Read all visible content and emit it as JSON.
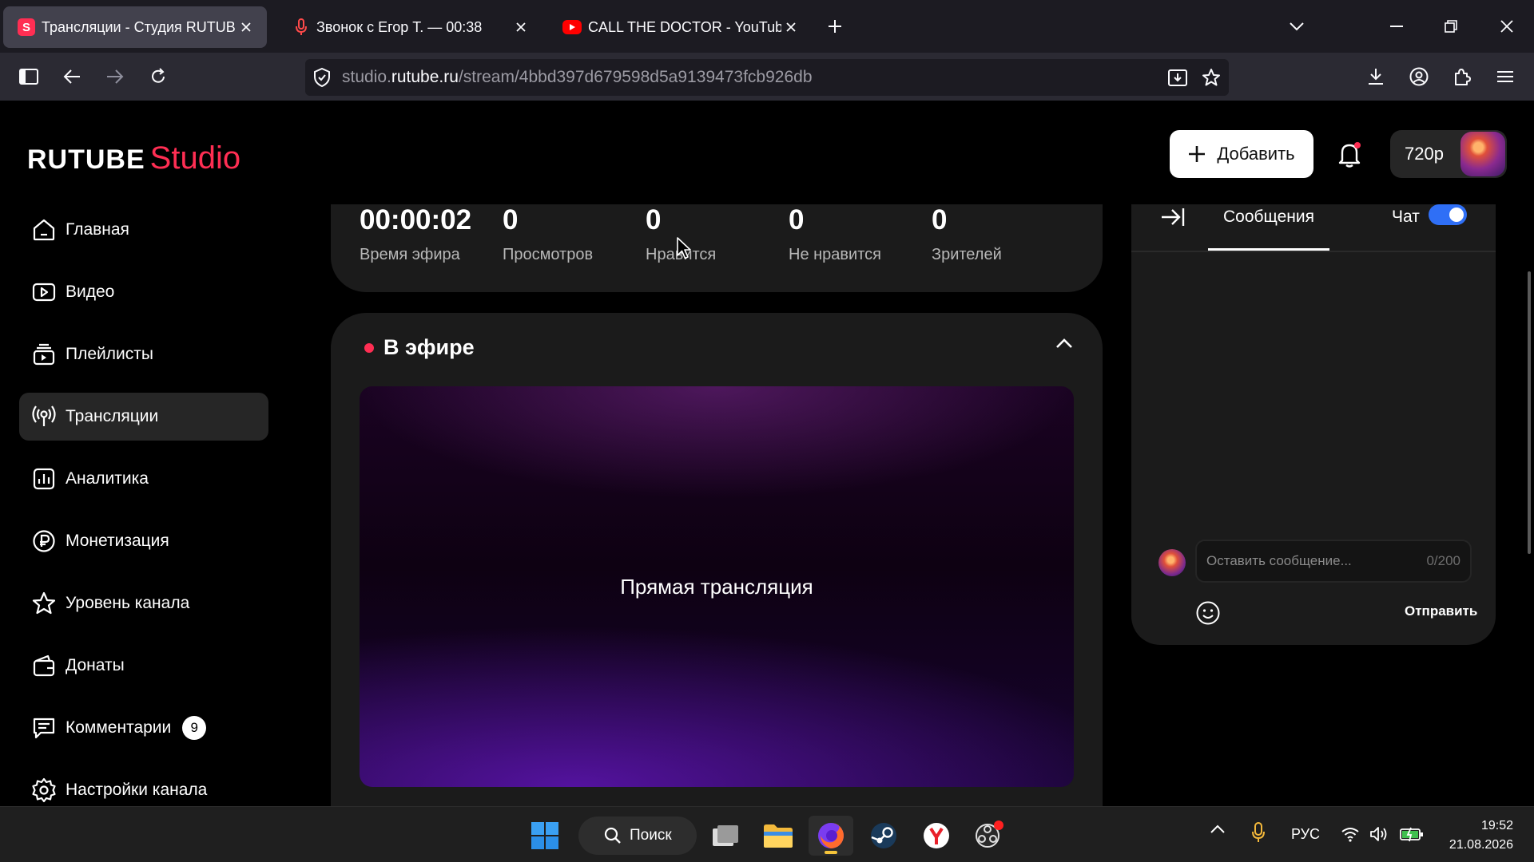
{
  "browser": {
    "tabs": [
      {
        "title": "Трансляции - Студия RUTUBE",
        "active": true
      },
      {
        "title": "Звонок с Егор Т. — 00:38",
        "active": false
      },
      {
        "title": "CALL THE DOCTOR - YouTube",
        "active": false
      }
    ],
    "url_domain_pre": "studio.",
    "url_domain": "rutube.ru",
    "url_path": "/stream/4bbd397d679598d5a9139473fcb926db"
  },
  "header": {
    "logo_main": "RUTUBE",
    "logo_sub": "Studio",
    "add_label": "Добавить",
    "quality": "720p"
  },
  "sidebar": {
    "items": [
      {
        "label": "Главная",
        "icon": "home-icon"
      },
      {
        "label": "Видео",
        "icon": "video-icon"
      },
      {
        "label": "Плейлисты",
        "icon": "playlist-icon"
      },
      {
        "label": "Трансляции",
        "icon": "broadcast-icon",
        "active": true
      },
      {
        "label": "Аналитика",
        "icon": "analytics-icon"
      },
      {
        "label": "Монетизация",
        "icon": "ruble-icon"
      },
      {
        "label": "Уровень канала",
        "icon": "star-icon"
      },
      {
        "label": "Донаты",
        "icon": "wallet-icon"
      },
      {
        "label": "Комментарии",
        "icon": "comments-icon",
        "badge": "9"
      },
      {
        "label": "Настройки канала",
        "icon": "gear-icon"
      }
    ]
  },
  "stats": [
    {
      "value": "00:00:02",
      "label": "Время эфира"
    },
    {
      "value": "0",
      "label": "Просмотров"
    },
    {
      "value": "0",
      "label": "Нравится"
    },
    {
      "value": "0",
      "label": "Не нравится"
    },
    {
      "value": "0",
      "label": "Зрителей"
    }
  ],
  "live": {
    "title": "В эфире",
    "player_text": "Прямая трансляция"
  },
  "chat": {
    "tab_messages": "Сообщения",
    "chat_label": "Чат",
    "toggle_on": true,
    "placeholder": "Оставить сообщение...",
    "counter": "0/200",
    "send_label": "Отправить"
  },
  "taskbar": {
    "search_label": "Поиск",
    "lang": "РУС",
    "time": "19:52",
    "date": "21.08.2026"
  },
  "colors": {
    "accent": "#ff2e53",
    "toggle": "#2f6ff6"
  }
}
